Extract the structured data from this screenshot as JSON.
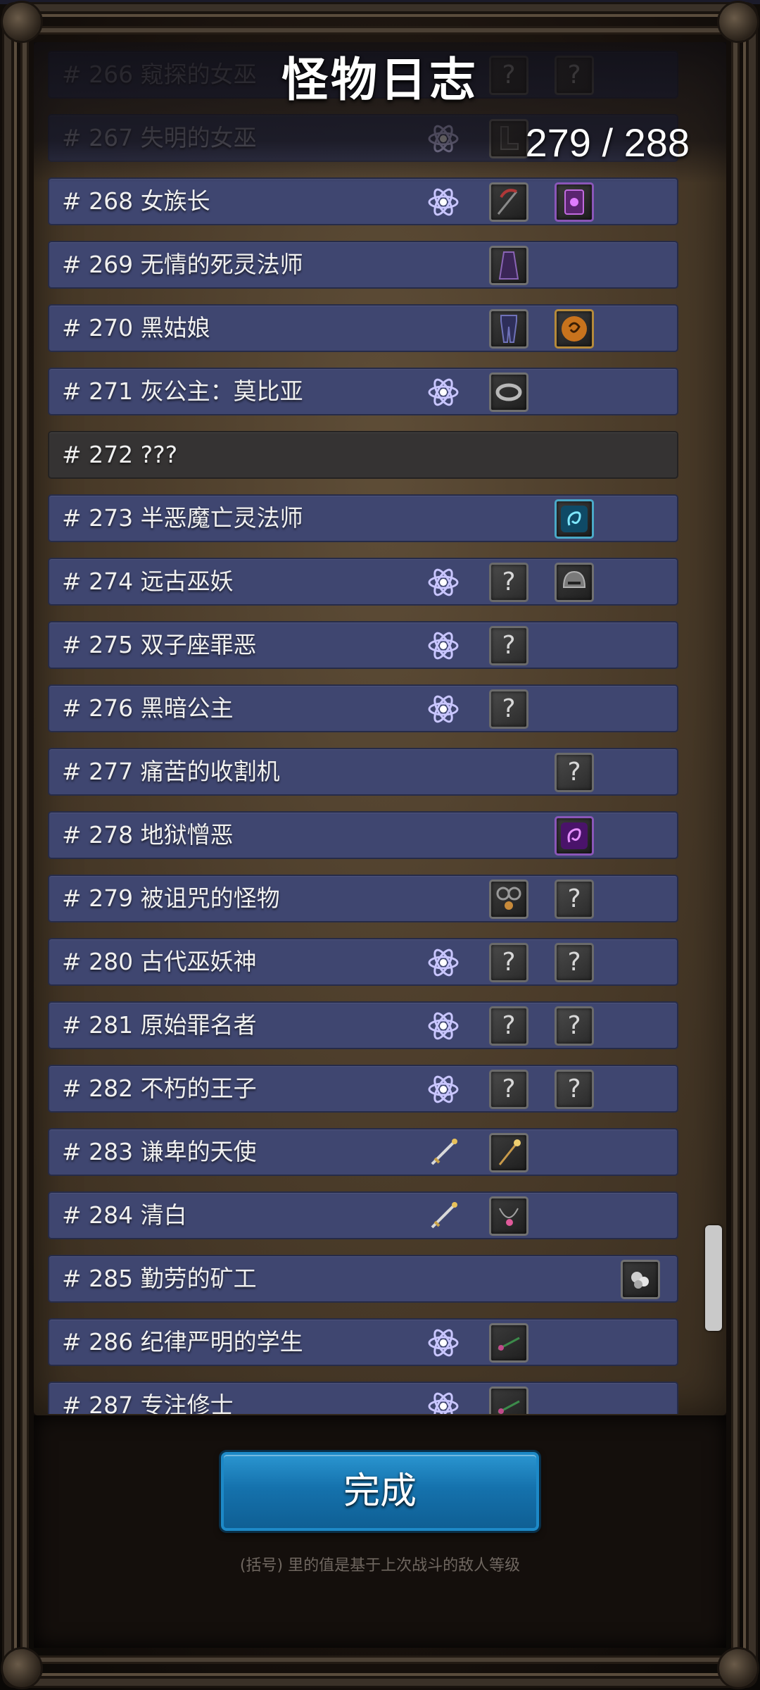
{
  "header": {
    "title": "怪物日志",
    "progress": "279 / 288"
  },
  "rows": [
    {
      "label": "# 266  窥探的女巫",
      "state": "faded",
      "slots": [
        {
          "pos": 2,
          "kind": "q",
          "text": "?"
        },
        {
          "pos": 3,
          "kind": "q",
          "text": "?"
        }
      ]
    },
    {
      "label": "# 267  失明的女巫",
      "state": "faded",
      "slots": [
        {
          "pos": 1,
          "kind": "atom"
        },
        {
          "pos": 2,
          "kind": "item",
          "icon": "boots-icon"
        }
      ]
    },
    {
      "label": "# 268  女族长",
      "state": "normal",
      "slots": [
        {
          "pos": 1,
          "kind": "atom"
        },
        {
          "pos": 2,
          "kind": "item",
          "icon": "scythe-icon"
        },
        {
          "pos": 3,
          "kind": "item",
          "icon": "spellbook-icon",
          "tone": "purple"
        }
      ]
    },
    {
      "label": "# 269  无情的死灵法师",
      "state": "normal",
      "slots": [
        {
          "pos": 2,
          "kind": "item",
          "icon": "robe-icon"
        }
      ]
    },
    {
      "label": "# 270  黑姑娘",
      "state": "normal",
      "slots": [
        {
          "pos": 2,
          "kind": "item",
          "icon": "leggings-icon"
        },
        {
          "pos": 3,
          "kind": "item",
          "icon": "orange-rune-icon",
          "tone": "gold"
        }
      ]
    },
    {
      "label": "# 271  灰公主：莫比亚",
      "state": "normal",
      "slots": [
        {
          "pos": 1,
          "kind": "atom"
        },
        {
          "pos": 2,
          "kind": "item",
          "icon": "ring-icon"
        }
      ]
    },
    {
      "label": "# 272  ???",
      "state": "locked",
      "slots": []
    },
    {
      "label": "# 273  半恶魔亡灵法师",
      "state": "normal",
      "slots": [
        {
          "pos": 3,
          "kind": "item",
          "icon": "cyan-rune-icon",
          "tone": "cyan"
        }
      ]
    },
    {
      "label": "# 274  远古巫妖",
      "state": "normal",
      "slots": [
        {
          "pos": 1,
          "kind": "atom"
        },
        {
          "pos": 2,
          "kind": "q",
          "text": "?"
        },
        {
          "pos": 3,
          "kind": "item",
          "icon": "helmet-icon"
        }
      ]
    },
    {
      "label": "# 275  双子座罪恶",
      "state": "normal",
      "slots": [
        {
          "pos": 1,
          "kind": "atom"
        },
        {
          "pos": 2,
          "kind": "q",
          "text": "?"
        }
      ]
    },
    {
      "label": "# 276  黑暗公主",
      "state": "normal",
      "slots": [
        {
          "pos": 1,
          "kind": "atom"
        },
        {
          "pos": 2,
          "kind": "q",
          "text": "?"
        }
      ]
    },
    {
      "label": "# 277  痛苦的收割机",
      "state": "normal",
      "slots": [
        {
          "pos": 3,
          "kind": "q",
          "text": "?"
        }
      ]
    },
    {
      "label": "# 278  地狱憎恶",
      "state": "normal",
      "slots": [
        {
          "pos": 3,
          "kind": "item",
          "icon": "purple-rune-icon",
          "tone": "purple"
        }
      ]
    },
    {
      "label": "# 279  被诅咒的怪物",
      "state": "normal",
      "slots": [
        {
          "pos": 2,
          "kind": "item",
          "icon": "amulet-icon"
        },
        {
          "pos": 3,
          "kind": "q",
          "text": "?"
        }
      ]
    },
    {
      "label": "# 280  古代巫妖神",
      "state": "normal",
      "slots": [
        {
          "pos": 1,
          "kind": "atom"
        },
        {
          "pos": 2,
          "kind": "q",
          "text": "?"
        },
        {
          "pos": 3,
          "kind": "q",
          "text": "?"
        }
      ]
    },
    {
      "label": "# 281  原始罪名者",
      "state": "normal",
      "slots": [
        {
          "pos": 1,
          "kind": "atom"
        },
        {
          "pos": 2,
          "kind": "q",
          "text": "?"
        },
        {
          "pos": 3,
          "kind": "q",
          "text": "?"
        }
      ]
    },
    {
      "label": "# 282  不朽的王子",
      "state": "normal",
      "slots": [
        {
          "pos": 1,
          "kind": "atom"
        },
        {
          "pos": 2,
          "kind": "q",
          "text": "?"
        },
        {
          "pos": 3,
          "kind": "q",
          "text": "?"
        }
      ]
    },
    {
      "label": "# 283  谦卑的天使",
      "state": "normal",
      "slots": [
        {
          "pos": 1,
          "kind": "item",
          "icon": "sword-icon",
          "bare": true
        },
        {
          "pos": 2,
          "kind": "item",
          "icon": "staff-icon"
        }
      ]
    },
    {
      "label": "# 284  清白",
      "state": "normal",
      "slots": [
        {
          "pos": 1,
          "kind": "item",
          "icon": "sword-icon",
          "bare": true
        },
        {
          "pos": 2,
          "kind": "item",
          "icon": "necklace-icon"
        }
      ]
    },
    {
      "label": "# 285  勤劳的矿工",
      "state": "normal",
      "slots": [
        {
          "pos": 4,
          "kind": "item",
          "icon": "ore-icon"
        }
      ]
    },
    {
      "label": "# 286  纪律严明的学生",
      "state": "normal",
      "slots": [
        {
          "pos": 1,
          "kind": "atom"
        },
        {
          "pos": 2,
          "kind": "item",
          "icon": "wand-icon"
        }
      ]
    },
    {
      "label": "# 287  专注修士",
      "state": "normal",
      "slots": [
        {
          "pos": 1,
          "kind": "atom"
        },
        {
          "pos": 2,
          "kind": "item",
          "icon": "wand-icon"
        }
      ]
    }
  ],
  "footer": {
    "done_label": "完成",
    "note": "(括号) 里的值是基于上次战斗的敌人等级"
  },
  "colors": {
    "row_bg": "#3f4670",
    "row_locked_bg": "#353333",
    "button_blue": "#1572ad"
  }
}
